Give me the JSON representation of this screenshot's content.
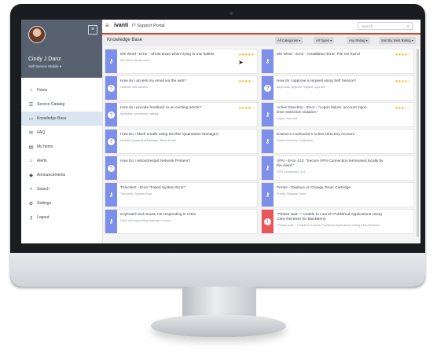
{
  "app": {
    "brand": "ivanti",
    "portal_title": "IT Support Portal",
    "accent_color": "#d7442e"
  },
  "search": {
    "placeholder": "Search"
  },
  "user": {
    "name": "Cindy J Danz",
    "role": "Self Service Mobile ▾"
  },
  "nav": [
    {
      "label": "Home",
      "icon": "home-icon"
    },
    {
      "label": "Service Catalog",
      "icon": "catalog-icon"
    },
    {
      "label": "Knowledge Base",
      "icon": "book-icon",
      "active": true
    },
    {
      "label": "FAQ",
      "icon": "chat-icon"
    },
    {
      "label": "My Items",
      "icon": "items-icon"
    },
    {
      "label": "Alerts",
      "icon": "bell-icon"
    },
    {
      "label": "Announcements",
      "icon": "megaphone-icon"
    },
    {
      "label": "Search",
      "icon": "search-icon"
    },
    {
      "label": "Settings",
      "icon": "gear-icon"
    },
    {
      "label": "Logout",
      "icon": "key-icon"
    }
  ],
  "kb": {
    "title": "Knowledge Base",
    "filters": [
      "All Categories ▾",
      "All Types ▾",
      "Any Rating ▾",
      "Sort By: Best Rating ▾"
    ]
  },
  "articles": [
    {
      "title": "MS Word - Error - Shuts down when trying to use bullets",
      "sub": "MS Word, Shuts down",
      "stars": "★★★★★",
      "icon": "key"
    },
    {
      "title": "MS Word - Error - Installation Error: File not found",
      "sub": "",
      "stars": "★★★★☆",
      "icon": "key"
    },
    {
      "title": "How do I access my email via the web?",
      "sub": "Outlook, web access",
      "stars": "★★★★☆",
      "icon": "question"
    },
    {
      "title": "How do I approve a request using Self Service?",
      "sub": "approvals, approve request, approve",
      "stars": "★★★★☆",
      "icon": "question"
    },
    {
      "title": "How do I provide feedback to an existing article?",
      "sub": "feedback, comments, ratings",
      "stars": "★★★★☆",
      "icon": "question"
    },
    {
      "title": "Active Directory - Error - \"Logon failure: account logon time restriction violation.\"",
      "sub": "Logon, account",
      "stars": "★★★☆☆",
      "icon": "key"
    },
    {
      "title": "How Do I block emails using McAfee Quarantine Manager?",
      "sub": "McAfee Quarantine Manager, Block Email",
      "stars": "",
      "icon": "question"
    },
    {
      "title": "Extend a Contractor's Active Directory Account",
      "sub": "Active Directory, Contractor",
      "stars": "",
      "icon": "key"
    },
    {
      "title": "How Do I reboot/restart Network Printers?",
      "sub": "",
      "stars": "",
      "icon": "question"
    },
    {
      "title": "VPN - Error 413: \"Secure VPN Connection terminated locally by the client.\"",
      "sub": "VPN Connection, 413",
      "stars": "",
      "icon": "key"
    },
    {
      "title": "Thinclient - Error \"Failed System Error\"",
      "sub": "Thinclient, System Error",
      "stars": "",
      "icon": "key"
    },
    {
      "title": "Printer - Replace or Change Toner Cartridge",
      "sub": "Printer, Replace Toner",
      "stars": "",
      "icon": "key"
    },
    {
      "title": "Keyboard and mouse not responding in Citrix",
      "sub": "Citrix not responding keyboard mouse",
      "stars": "",
      "icon": "key"
    },
    {
      "title": "\"Please wait...\" Unable to Launch Published Applications Using Citrix Receiver for BlackBerry",
      "sub": "\"Please wait...\" Unable to Launch Published Applications Using Citrix Receive...",
      "stars": "",
      "icon": "alert"
    }
  ]
}
